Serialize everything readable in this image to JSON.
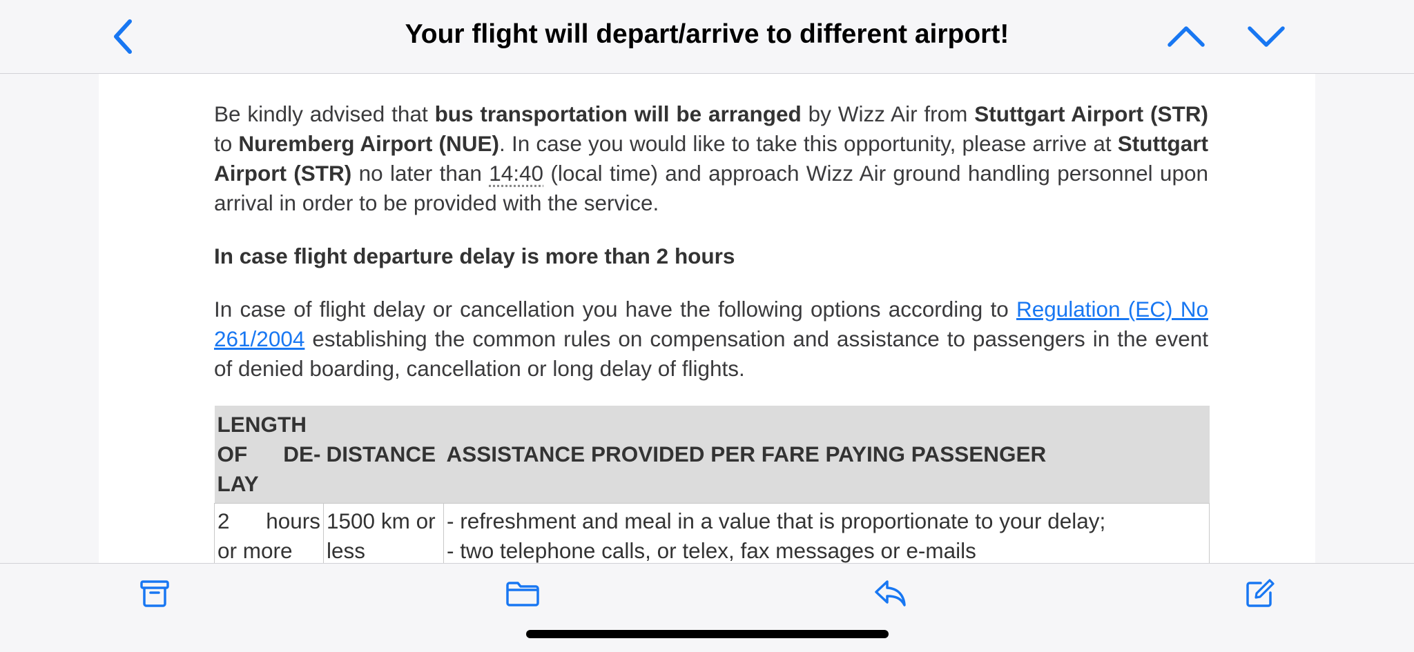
{
  "header": {
    "title": "Your flight will depart/arrive to different airport!",
    "back_icon": "chevron-left-icon",
    "prev_icon": "chevron-up-icon",
    "next_icon": "chevron-down-icon",
    "accent_color": "#1877f2"
  },
  "body": {
    "p1": {
      "s1": "Be kindly advised that ",
      "b1": "bus transportation will be arranged",
      "s2": " by Wizz Air from ",
      "b2": "Stuttgart Airport (STR)",
      "s3": " to ",
      "b3": "Nuremberg Airport (NUE)",
      "s4": ". In case you would like to take this opportunity, please arrive at ",
      "b4": "Stuttgart Airport (STR)",
      "s5": " no later than ",
      "time": "14:40",
      "s6": " (local time) and approach Wizz Air ground handling personnel upon arrival in order to be provided with the service."
    },
    "heading": "In case flight departure delay is more than 2 hours",
    "p2": {
      "s1": "In case of flight delay or cancellation you have the following options according to ",
      "link": "Regulation (EC) No 261/2004",
      "s2": " establishing the common rules on compensation and assistance to passengers in the event of denied boarding, cancellation or long delay of flights."
    }
  },
  "table": {
    "headers": [
      "LENGTH OF DE- LAY",
      "DISTANCE",
      "ASSISTANCE PROVIDED PER FARE PAYING PASSENGER"
    ],
    "header_lines": [
      "LENGTH",
      "OF DE-",
      "LAY"
    ],
    "rows": [
      {
        "length_lines": [
          "2 hours",
          "or more"
        ],
        "distance_lines": [
          "1500 km or",
          "less"
        ],
        "assistance_lines": [
          "- refreshment and meal in a value that is proportionate to your delay;",
          "- two telephone calls, or telex, fax messages or e-mails"
        ]
      }
    ]
  },
  "toolbar": {
    "archive_icon": "archive-box-icon",
    "folder_icon": "folder-icon",
    "reply_icon": "reply-icon",
    "compose_icon": "compose-icon"
  }
}
